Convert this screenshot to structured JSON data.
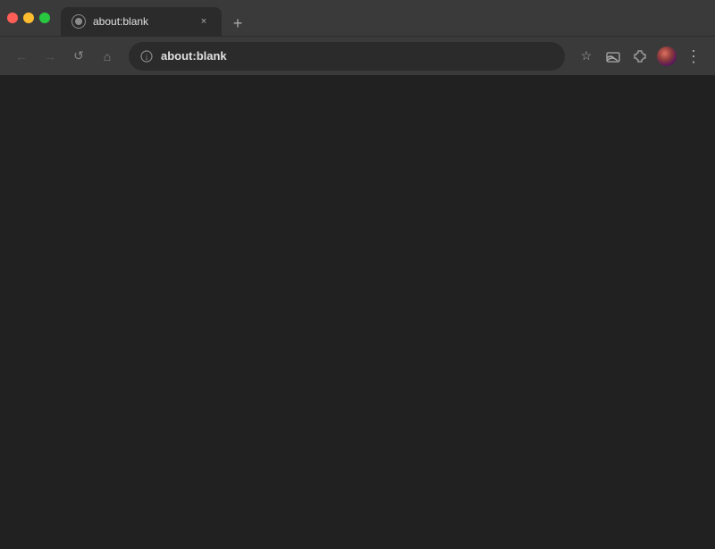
{
  "titlebar": {
    "traffic_lights": {
      "close_color": "#ff5f57",
      "minimize_color": "#febc2e",
      "maximize_color": "#28c840"
    }
  },
  "tab": {
    "title": "about:blank",
    "favicon_alt": "page-favicon",
    "close_label": "×"
  },
  "new_tab": {
    "label": "+"
  },
  "navbar": {
    "back_label": "←",
    "forward_label": "→",
    "reload_label": "↺",
    "home_label": "⌂",
    "address": "about:blank",
    "address_display": "about:blank",
    "bookmark_label": "☆",
    "extensions_label": "⧉",
    "puzzle_label": "⊞",
    "menu_label": "⋮"
  },
  "page": {
    "background": "#212121"
  }
}
